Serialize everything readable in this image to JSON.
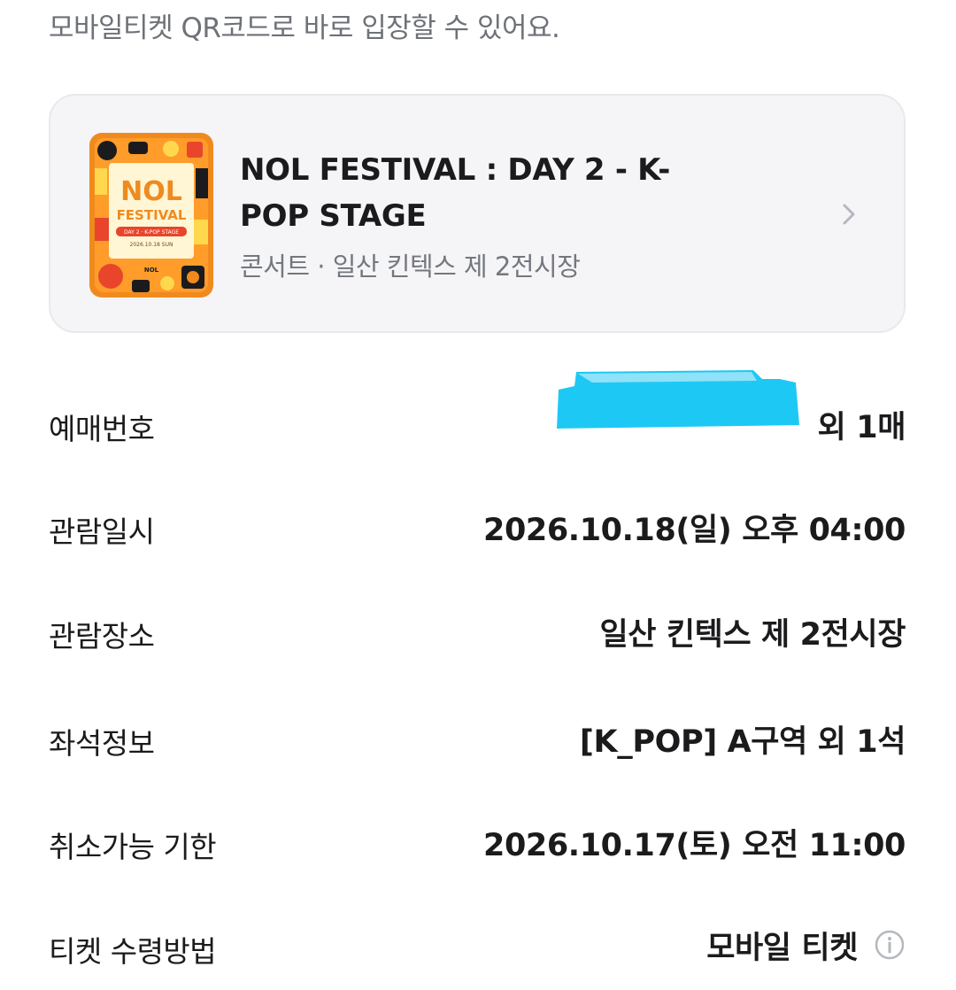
{
  "notice": "모바일티켓 QR코드로 바로 입장할 수 있어요.",
  "event": {
    "title": "NOL FESTIVAL : DAY 2 - K-POP STAGE",
    "subtitle": "콘서트 · 일산 킨텍스 제 2전시장",
    "poster": {
      "logo_line1": "NOL",
      "logo_line2": "FESTIVAL",
      "ribbon": "DAY 2 · K-POP STAGE",
      "date": "2026.10.18 SUN",
      "brand": "NOL"
    },
    "chevron_icon": "chevron-right-icon"
  },
  "details": {
    "reservation": {
      "label": "예매번호",
      "value": "외 1매"
    },
    "datetime": {
      "label": "관람일시",
      "value": "2026.10.18(일) 오후 04:00"
    },
    "venue": {
      "label": "관람장소",
      "value": "일산 킨텍스 제 2전시장"
    },
    "seat": {
      "label": "좌석정보",
      "value": "[K_POP] A구역 외 1석"
    },
    "cancel_deadline": {
      "label": "취소가능 기한",
      "value": "2026.10.17(토) 오전 11:00"
    },
    "ticket_method": {
      "label": "티켓 수령방법",
      "value": "모바일 티켓",
      "icon": "info-icon"
    }
  },
  "colors": {
    "text_primary": "#1b1b1d",
    "text_secondary": "#6e7178",
    "card_bg": "#f5f5f7",
    "redaction": "#1ec8f5",
    "poster_orange": "#f08a1e",
    "poster_yellow": "#ffd84d",
    "poster_red": "#e8452c"
  }
}
